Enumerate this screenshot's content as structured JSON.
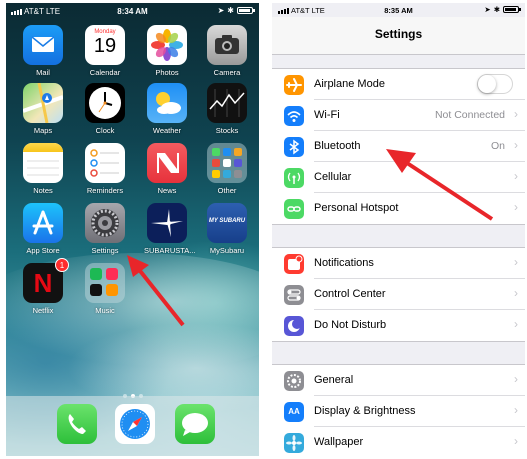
{
  "home_screen": {
    "status_bar": {
      "carrier": "AT&T",
      "network": "LTE",
      "time": "8:34 AM"
    },
    "apps": [
      {
        "label": "Mail",
        "icon": "mail-icon"
      },
      {
        "label": "Calendar",
        "icon": "calendar-icon",
        "weekday": "Monday",
        "day": "19"
      },
      {
        "label": "Photos",
        "icon": "photos-icon"
      },
      {
        "label": "Camera",
        "icon": "camera-icon"
      },
      {
        "label": "Maps",
        "icon": "maps-icon"
      },
      {
        "label": "Clock",
        "icon": "clock-icon"
      },
      {
        "label": "Weather",
        "icon": "weather-icon"
      },
      {
        "label": "Stocks",
        "icon": "stocks-icon"
      },
      {
        "label": "Notes",
        "icon": "notes-icon"
      },
      {
        "label": "Reminders",
        "icon": "reminders-icon"
      },
      {
        "label": "News",
        "icon": "news-icon"
      },
      {
        "label": "Other",
        "icon": "folder-icon"
      },
      {
        "label": "App Store",
        "icon": "app-store-icon"
      },
      {
        "label": "Settings",
        "icon": "settings-gear-icon"
      },
      {
        "label": "SUBARUSTA...",
        "icon": "subaru-starlink-icon"
      },
      {
        "label": "MySubaru",
        "icon": "mysubaru-icon",
        "icon_text": "MY SUBARU"
      },
      {
        "label": "Netflix",
        "icon": "netflix-icon",
        "badge": "1",
        "icon_text": "N"
      },
      {
        "label": "Music",
        "icon": "music-folder-icon"
      }
    ],
    "dock": [
      {
        "icon": "phone-icon"
      },
      {
        "icon": "safari-icon"
      },
      {
        "icon": "messages-icon"
      }
    ],
    "colors": {
      "arrow": "#e8262a"
    }
  },
  "settings_screen": {
    "status_bar": {
      "carrier": "AT&T",
      "network": "LTE",
      "time": "8:35 AM"
    },
    "title": "Settings",
    "groups": [
      [
        {
          "label": "Airplane Mode",
          "icon": "airplane-icon",
          "color": "#ff9500",
          "control": "toggle-off"
        },
        {
          "label": "Wi-Fi",
          "icon": "wifi-icon",
          "color": "#147efb",
          "value": "Not Connected"
        },
        {
          "label": "Bluetooth",
          "icon": "bluetooth-icon",
          "color": "#147efb",
          "value": "On"
        },
        {
          "label": "Cellular",
          "icon": "cellular-icon",
          "color": "#4cd964"
        },
        {
          "label": "Personal Hotspot",
          "icon": "hotspot-icon",
          "color": "#4cd964"
        }
      ],
      [
        {
          "label": "Notifications",
          "icon": "notifications-icon",
          "color": "#ff3b30"
        },
        {
          "label": "Control Center",
          "icon": "control-center-icon",
          "color": "#8e8e93"
        },
        {
          "label": "Do Not Disturb",
          "icon": "moon-icon",
          "color": "#5856d6"
        }
      ],
      [
        {
          "label": "General",
          "icon": "gear-icon",
          "color": "#8e8e93"
        },
        {
          "label": "Display & Brightness",
          "icon": "display-icon",
          "color": "#147efb",
          "icon_text": "AA"
        },
        {
          "label": "Wallpaper",
          "icon": "wallpaper-icon",
          "color": "#34aadc"
        }
      ]
    ]
  }
}
